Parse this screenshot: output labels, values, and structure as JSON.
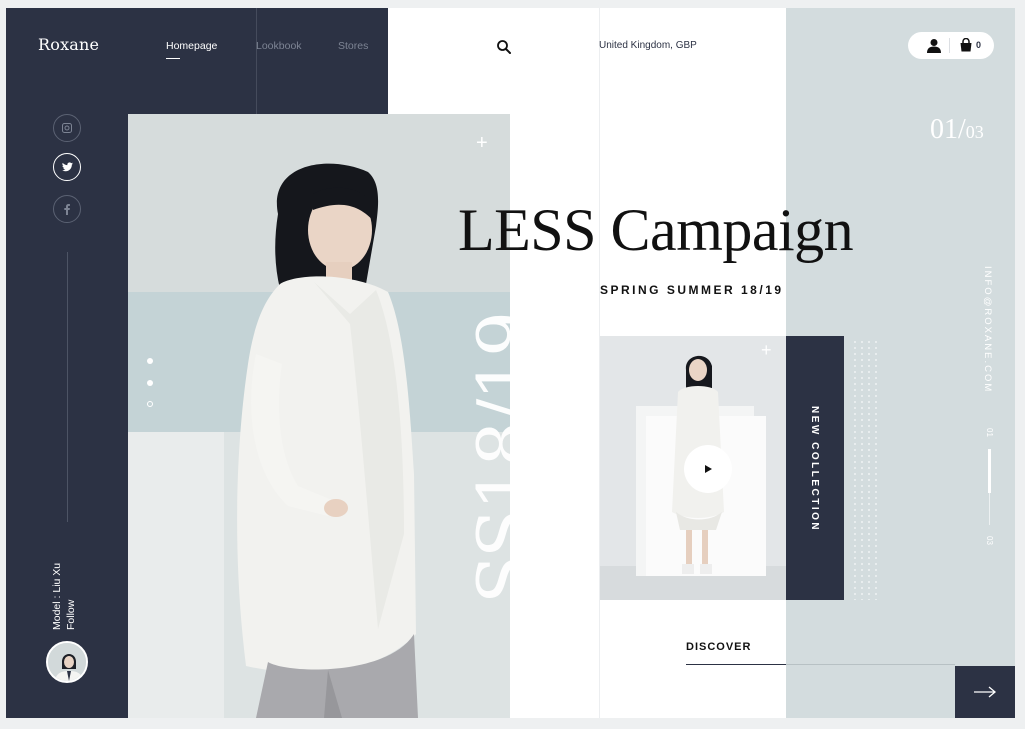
{
  "brand": {
    "logo": "Roxane"
  },
  "nav": [
    {
      "label": "Homepage",
      "active": true
    },
    {
      "label": "Lookbook",
      "active": false
    },
    {
      "label": "Stores",
      "active": false
    }
  ],
  "header": {
    "region": "United Kingdom, GBP",
    "cart_count": "0"
  },
  "social": [
    "instagram-icon",
    "twitter-icon",
    "facebook-icon"
  ],
  "model": {
    "credit": "Model : Liu Xu",
    "follow": "Follow"
  },
  "hero": {
    "title": "LESS Campaign",
    "season": "SPRING SUMMER 18/19",
    "vertical_text": "SS18/19",
    "slide_current": "01/",
    "slide_total": "03",
    "collection": "NEW COLLECTION",
    "discover": "DISCOVER"
  },
  "contact": {
    "email": "INFO@ROXANE.COM"
  },
  "progress": {
    "start": "01",
    "end": "03",
    "fraction": 0.58
  },
  "colors": {
    "navy": "#2c3244",
    "panel": "#d3dcde",
    "white": "#ffffff"
  }
}
